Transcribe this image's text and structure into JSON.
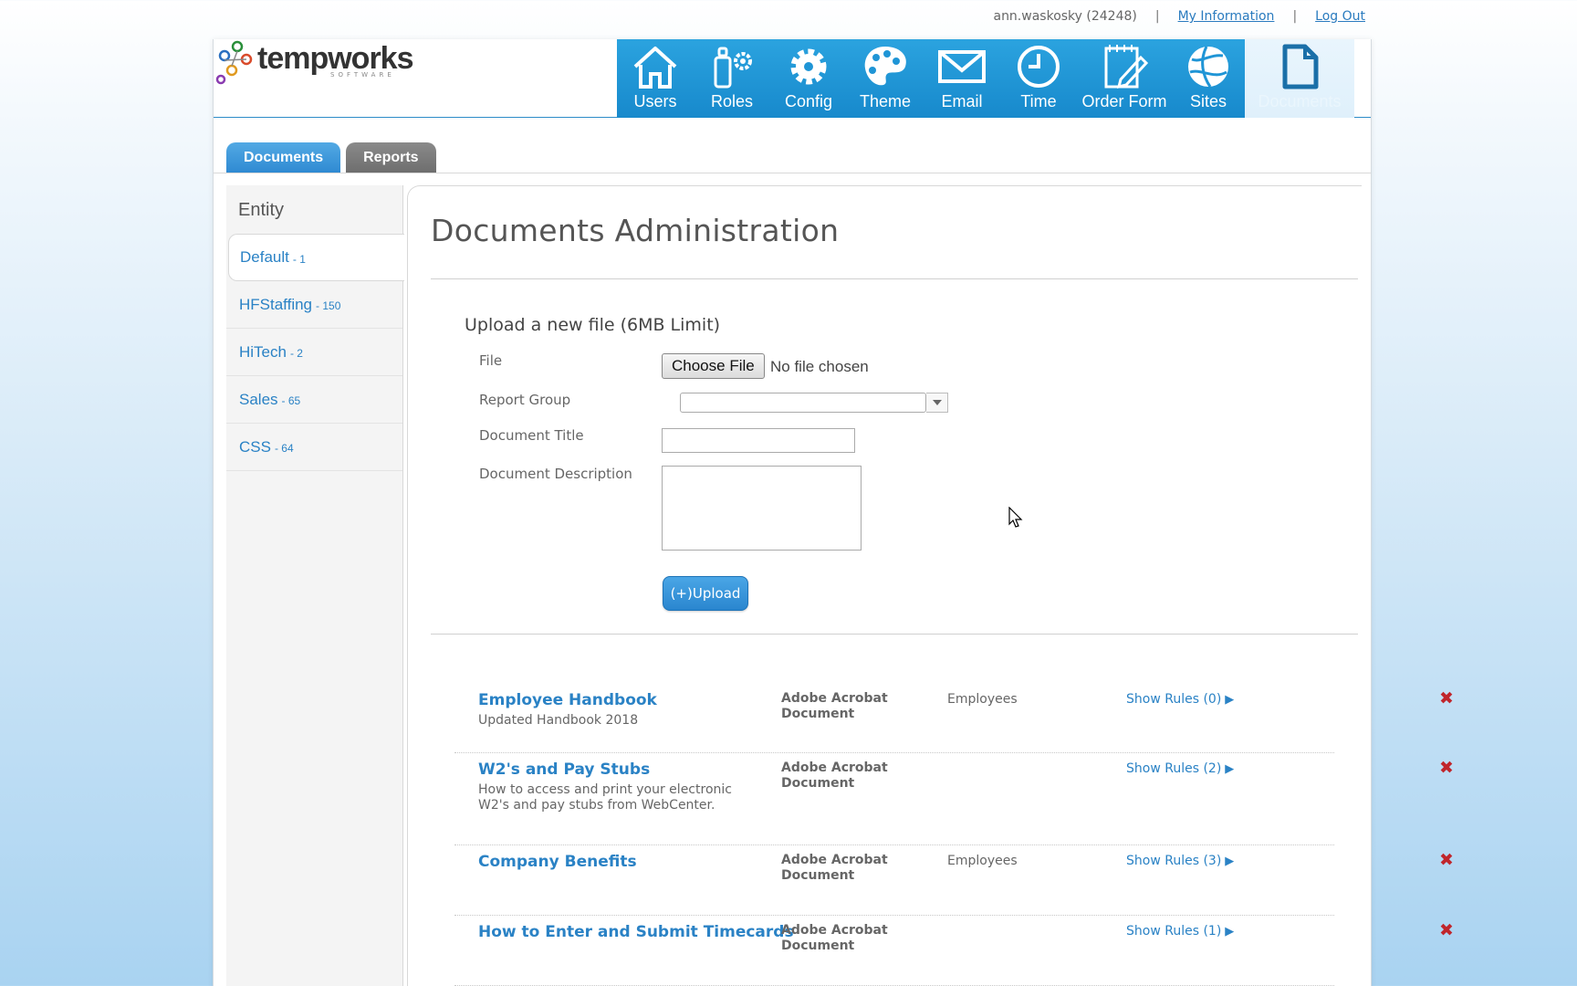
{
  "userbar": {
    "user": "ann.waskosky (24248)",
    "sep1": "|",
    "my_info": "My Information",
    "sep2": "|",
    "logout": "Log Out"
  },
  "logo": {
    "name": "tempworks",
    "sub": "SOFTWARE"
  },
  "nav": [
    {
      "label": "Users",
      "icon": "house-icon"
    },
    {
      "label": "Roles",
      "icon": "roles-icon"
    },
    {
      "label": "Config",
      "icon": "gear-icon"
    },
    {
      "label": "Theme",
      "icon": "palette-icon"
    },
    {
      "label": "Email",
      "icon": "envelope-icon"
    },
    {
      "label": "Time",
      "icon": "clock-icon"
    },
    {
      "label": "Order Form",
      "icon": "order-form-icon"
    },
    {
      "label": "Sites",
      "icon": "globe-icon"
    },
    {
      "label": "Documents",
      "icon": "document-icon",
      "active": true
    }
  ],
  "tabs": {
    "documents": "Documents",
    "reports": "Reports"
  },
  "sidebar": {
    "heading": "Entity",
    "items": [
      {
        "name": "Default",
        "count": "- 1",
        "selected": true
      },
      {
        "name": "HFStaffing",
        "count": "- 150"
      },
      {
        "name": "HiTech",
        "count": "- 2"
      },
      {
        "name": "Sales",
        "count": "- 65"
      },
      {
        "name": "CSS",
        "count": "- 64"
      }
    ]
  },
  "main": {
    "title": "Documents Administration",
    "upload_title": "Upload a new file (6MB Limit)",
    "labels": {
      "file": "File",
      "report_group": "Report Group",
      "document_title": "Document Title",
      "document_description": "Document Description"
    },
    "choose_file": "Choose File",
    "no_file": "No file chosen",
    "report_group_value": "",
    "document_title_value": "",
    "document_description_value": "",
    "upload_button": "(+)Upload"
  },
  "documents": [
    {
      "title": "Employee Handbook",
      "description": "Updated Handbook 2018",
      "type": "Adobe Acrobat Document",
      "group": "Employees",
      "rules": "Show Rules (0)"
    },
    {
      "title": "W2's and Pay Stubs",
      "description": "How to access and print your electronic W2's and pay stubs from WebCenter.",
      "type": "Adobe Acrobat Document",
      "group": "",
      "rules": "Show Rules (2)"
    },
    {
      "title": "Company Benefits",
      "description": "",
      "type": "Adobe Acrobat Document",
      "group": "Employees",
      "rules": "Show Rules (3)"
    },
    {
      "title": "How to Enter and Submit Timecards",
      "description": "",
      "type": "Adobe Acrobat Document",
      "group": "",
      "rules": "Show Rules (1)"
    }
  ],
  "colors": {
    "accent": "#2a82c5",
    "nav_bg": "#1f95d6",
    "delete": "#c0262c"
  }
}
